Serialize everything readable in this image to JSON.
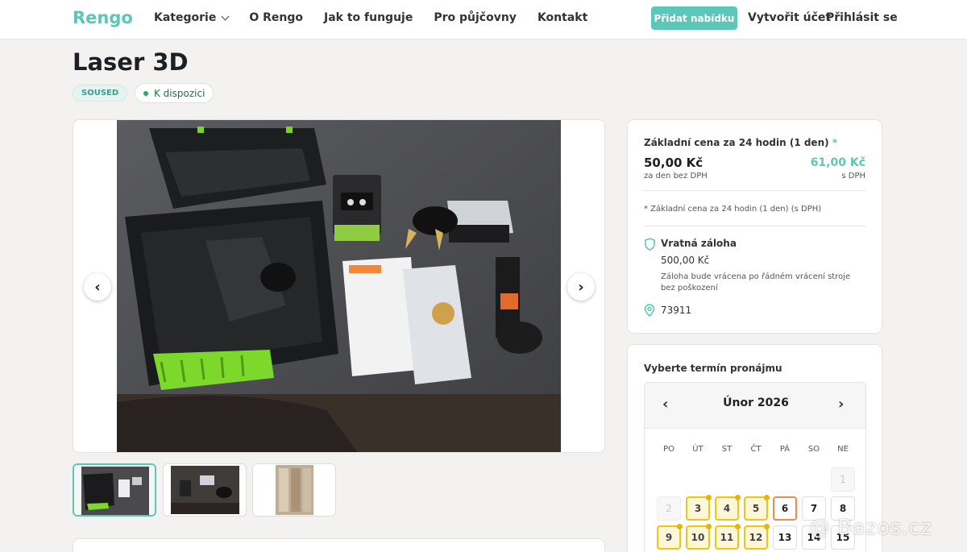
{
  "header": {
    "logo": "Rengo",
    "nav": [
      "Kategorie",
      "O Rengo",
      "Jak to funguje",
      "Pro půjčovny",
      "Kontakt"
    ],
    "offer_button": "Přidat nabídku",
    "create_account": "Vytvořit účet",
    "login": "Přihlásit se"
  },
  "listing": {
    "title": "Laser 3D",
    "badge_condition": "SOUSED",
    "badge_availability": "K dispozici"
  },
  "gallery": {
    "thumbnail_count": 3,
    "active_thumbnail": 1
  },
  "price": {
    "label": "Základní cena za 24 hodin (1 den)",
    "required_mark": "*",
    "net": "50,00 Kč",
    "net_note": "za den bez DPH",
    "gross": "61,00 Kč",
    "gross_note": "s DPH",
    "footnote": "* Základní cena za 24 hodin (1 den) (s DPH)",
    "deposit_title": "Vratná záloha",
    "deposit_value": "500,00 Kč",
    "deposit_note": "Záloha bude vrácena po řádném vrácení stroje bez poškození",
    "zip": "73911",
    "accent": "#5cc7b8"
  },
  "calendar": {
    "label": "Vyberte termín pronájmu",
    "month": "Únor 2026",
    "prev": "‹",
    "next": "›",
    "weekdays": [
      "PO",
      "ÚT",
      "ST",
      "ČT",
      "PÁ",
      "SO",
      "NE"
    ],
    "days_row1": [
      "1"
    ],
    "days_row2": [
      "2",
      "3",
      "4",
      "5",
      "6",
      "7",
      "8"
    ],
    "days_row3": [
      "9",
      "10",
      "11",
      "12",
      "13",
      "14",
      "15"
    ]
  },
  "watermark": "@ Bazos.cz"
}
